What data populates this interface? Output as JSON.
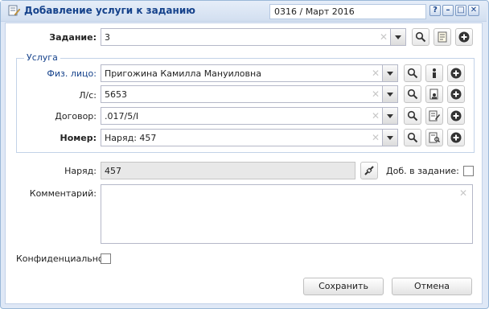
{
  "window": {
    "title": "Добавление услуги к заданию",
    "period": "0316 / Март 2016",
    "btn_help": "?",
    "btn_min": "–",
    "btn_max": "□",
    "btn_close": "✕"
  },
  "task": {
    "label": "Задание:",
    "value": "3"
  },
  "service": {
    "legend": "Услуга",
    "person": {
      "label": "Физ. лицо:",
      "value": "Пригожина Камилла Мануиловна"
    },
    "account": {
      "label": "Л/с:",
      "value": "5653"
    },
    "contract": {
      "label": "Договор:",
      "value": ".017/5/I"
    },
    "number": {
      "label": "Номер:",
      "value": "Наряд: 457"
    }
  },
  "order": {
    "label": "Наряд:",
    "value": "457",
    "add_to_task_label": "Доб. в задание:",
    "add_to_task_checked": false
  },
  "comment": {
    "label": "Комментарий:",
    "value": ""
  },
  "confidential": {
    "label": "Конфиденциально:",
    "checked": false
  },
  "buttons": {
    "save": "Сохранить",
    "cancel": "Отмена"
  },
  "colors": {
    "accent": "#15428b",
    "frame": "#dfe8f6"
  }
}
